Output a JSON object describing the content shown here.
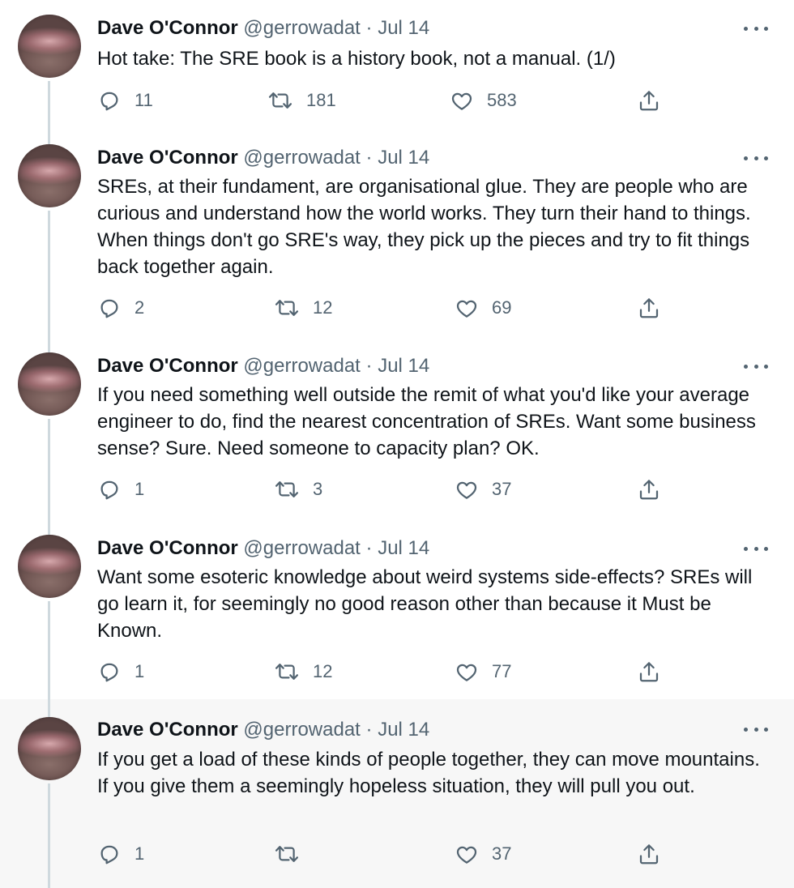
{
  "tweets": [
    {
      "author": "Dave O'Connor",
      "handle": "@gerrowadat",
      "separator": "·",
      "date": "Jul 14",
      "text": "Hot take: The SRE book is a history book, not a manual. (1/)",
      "replies": "11",
      "retweets": "181",
      "likes": "583"
    },
    {
      "author": "Dave O'Connor",
      "handle": "@gerrowadat",
      "separator": "·",
      "date": "Jul 14",
      "text": "SREs, at their fundament, are organisational glue. They are people who are curious and understand how the world works. They turn their hand to things. When things don't go SRE's way, they pick up the pieces and try to fit things back together again.",
      "replies": "2",
      "retweets": "12",
      "likes": "69"
    },
    {
      "author": "Dave O'Connor",
      "handle": "@gerrowadat",
      "separator": "·",
      "date": "Jul 14",
      "text": "If you need something well outside the remit of what you'd like your average engineer to do, find the nearest concentration of SREs. Want some business sense? Sure. Need someone to capacity plan? OK.",
      "replies": "1",
      "retweets": "3",
      "likes": "37"
    },
    {
      "author": "Dave O'Connor",
      "handle": "@gerrowadat",
      "separator": "·",
      "date": "Jul 14",
      "text": "Want some esoteric knowledge about weird systems side-effects? SREs will go learn it, for seemingly no good reason other than because it Must be Known.",
      "replies": "1",
      "retweets": "12",
      "likes": "77"
    },
    {
      "author": "Dave O'Connor",
      "handle": "@gerrowadat",
      "separator": "·",
      "date": "Jul 14",
      "text": "If you get a load of these kinds of people together, they can move mountains. If you give them a seemingly hopeless situation, they will pull you out.",
      "replies": "1",
      "retweets": "",
      "likes": "37"
    }
  ],
  "icons": {
    "more": "more-horizontal-icon",
    "reply": "reply-bubble-icon",
    "retweet": "retweet-arrows-icon",
    "like": "heart-icon",
    "share": "share-upload-icon"
  },
  "colors": {
    "text": "#0f1419",
    "secondary": "#536471",
    "thread_line": "#cfd9de",
    "highlight_background": "#f7f7f7"
  }
}
